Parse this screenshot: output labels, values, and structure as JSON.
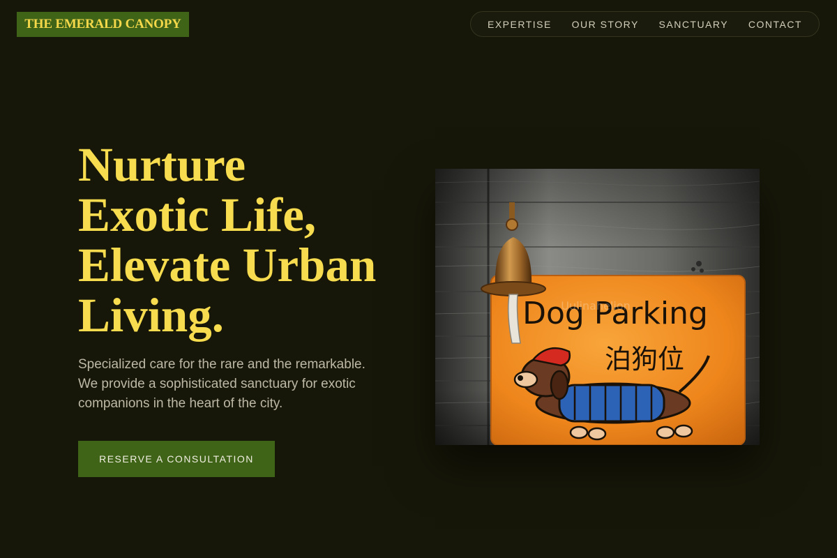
{
  "brand": {
    "logo_text": "THE EMERALD CANOPY"
  },
  "nav": {
    "items": [
      {
        "label": "EXPERTISE"
      },
      {
        "label": "OUR STORY"
      },
      {
        "label": "SANCTUARY"
      },
      {
        "label": "CONTACT"
      }
    ]
  },
  "hero": {
    "title_lines": [
      "Nurture",
      "Exotic Life,",
      "Elevate Urban",
      "Living."
    ],
    "subtitle_lines": [
      "Specialized care for the rare and the remarkable.",
      "We provide a sophisticated sanctuary for exotic",
      "companions in the heart of the city."
    ],
    "cta_label": "RESERVE A CONSULTATION"
  },
  "photo": {
    "sign_text": "Dog Parking",
    "sign_chinese": "泊狗位",
    "watermark": "Uulinahelion",
    "colors": {
      "sign": "#f08a1e",
      "wood": "#6c6c68",
      "bell": "#b07830"
    }
  },
  "colors": {
    "background": "#171709",
    "accent_green": "#3f6418",
    "accent_yellow": "#f6dc4e"
  }
}
